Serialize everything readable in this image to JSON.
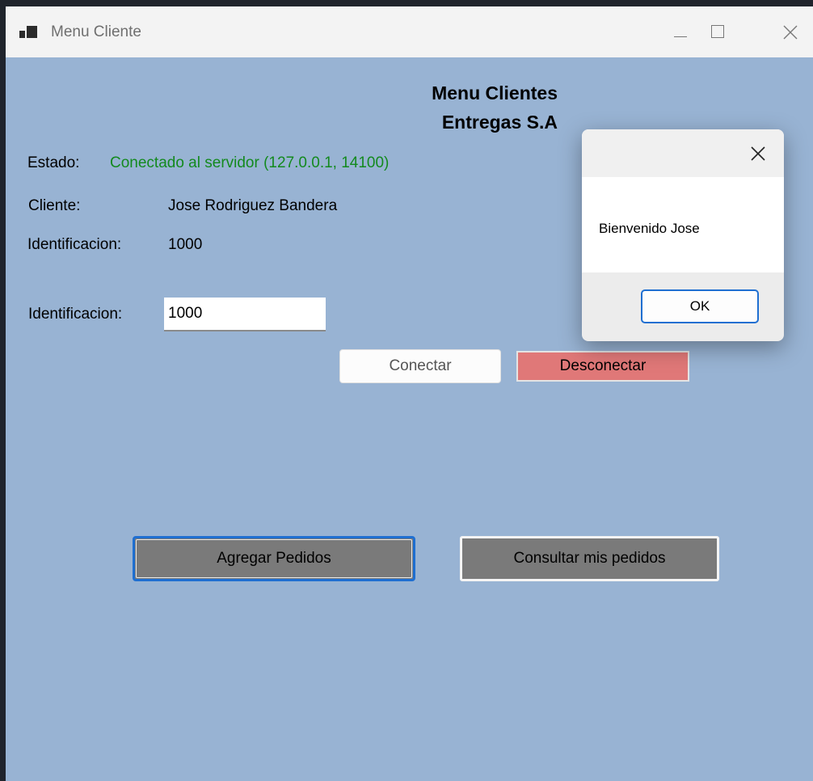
{
  "window": {
    "title": "Menu Cliente"
  },
  "header": {
    "line1": "Menu Clientes",
    "line2": "Entregas S.A"
  },
  "status": {
    "label": "Estado:",
    "value": "Conectado al servidor (127.0.0.1, 14100)",
    "color": "#138a1e"
  },
  "client": {
    "name_label": "Cliente:",
    "name_value": "Jose Rodriguez Bandera",
    "id_label": "Identificacion:",
    "id_value": "1000"
  },
  "form": {
    "id_label": "Identificacion:",
    "id_input_value": "1000"
  },
  "buttons": {
    "connect": "Conectar",
    "disconnect": "Desconectar",
    "add_orders": "Agregar Pedidos",
    "view_orders": "Consultar mis pedidos"
  },
  "dialog": {
    "message": "Bienvenido Jose",
    "ok": "OK"
  },
  "colors": {
    "background": "#98b3d3",
    "disconnect": "#e07878",
    "action_buttons": "#7a7a7a",
    "accent": "#1f6fd1"
  },
  "icons": {
    "app": "windows-forms-icon",
    "minimize": "minimize-icon",
    "maximize": "maximize-icon",
    "close": "close-icon"
  }
}
